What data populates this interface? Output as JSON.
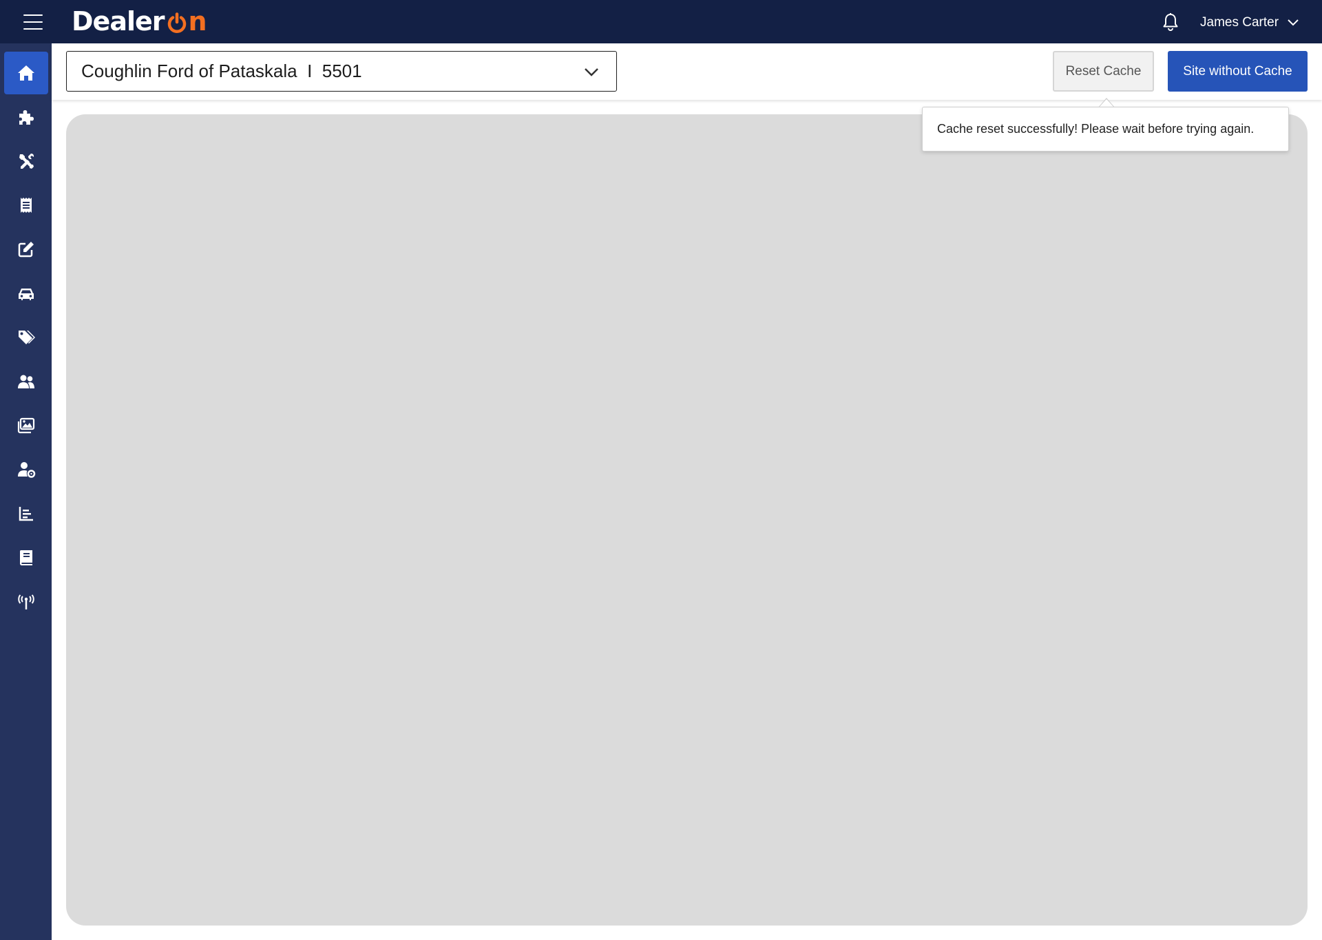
{
  "header": {
    "logo_text_main": "Dealer",
    "logo_text_accent": "n",
    "user_name": "James Carter"
  },
  "sidebar": {
    "items": [
      {
        "icon": "home-icon",
        "active": true
      },
      {
        "icon": "puzzle-icon",
        "active": false
      },
      {
        "icon": "tools-icon",
        "active": false
      },
      {
        "icon": "receipt-icon",
        "active": false
      },
      {
        "icon": "edit-icon",
        "active": false
      },
      {
        "icon": "car-icon",
        "active": false
      },
      {
        "icon": "tags-icon",
        "active": false
      },
      {
        "icon": "users-icon",
        "active": false
      },
      {
        "icon": "images-icon",
        "active": false
      },
      {
        "icon": "user-cog-icon",
        "active": false
      },
      {
        "icon": "chart-icon",
        "active": false
      },
      {
        "icon": "book-icon",
        "active": false
      },
      {
        "icon": "broadcast-icon",
        "active": false
      }
    ]
  },
  "toolbar": {
    "site_selector_value": "Coughlin Ford of Pataskala  I  5501",
    "reset_cache_label": "Reset Cache",
    "site_without_cache_label": "Site without Cache"
  },
  "tooltip": {
    "message": "Cache reset successfully! Please wait before trying again."
  },
  "colors": {
    "topbar": "#132045",
    "sidebar": "#25335e",
    "active_item": "#2b5ac6",
    "primary_button": "#2654b8",
    "logo_accent": "#f36f21",
    "canvas": "#dbdbdb"
  }
}
